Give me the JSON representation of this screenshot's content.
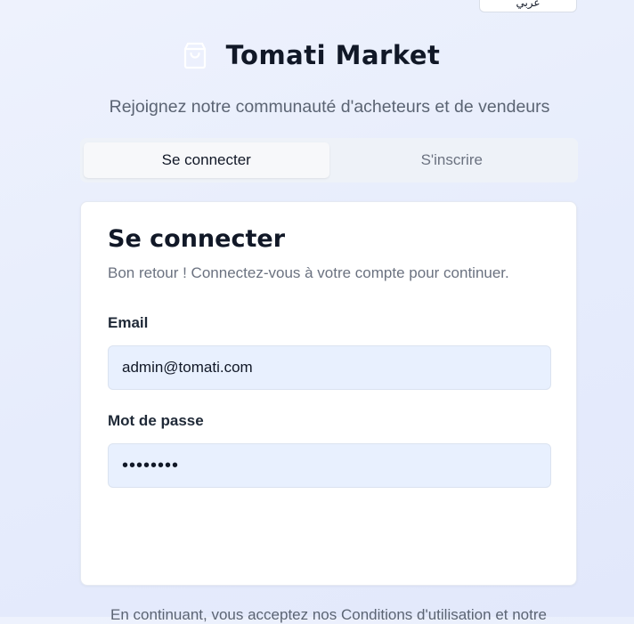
{
  "header": {
    "language_button_label": "عربي",
    "brand_icon": "shopping-bag-icon",
    "app_title": "Tomati Market",
    "tagline": "Rejoignez notre communauté d'acheteurs et de vendeurs"
  },
  "tabs": [
    {
      "label": "Se connecter",
      "active": true
    },
    {
      "label": "S'inscrire",
      "active": false
    }
  ],
  "login_card": {
    "title": "Se connecter",
    "subtitle": "Bon retour ! Connectez-vous à votre compte pour continuer.",
    "email": {
      "label": "Email",
      "value": "admin@tomati.com"
    },
    "password": {
      "label": "Mot de passe",
      "value": "••••••••"
    }
  },
  "footer": {
    "terms_text": "En continuant, vous acceptez nos Conditions d'utilisation et notre"
  },
  "colors": {
    "background": "#e8eefc",
    "input_fill": "#e8f0fe",
    "card": "#ffffff",
    "text_primary": "#111827",
    "text_muted": "#6b7280"
  }
}
